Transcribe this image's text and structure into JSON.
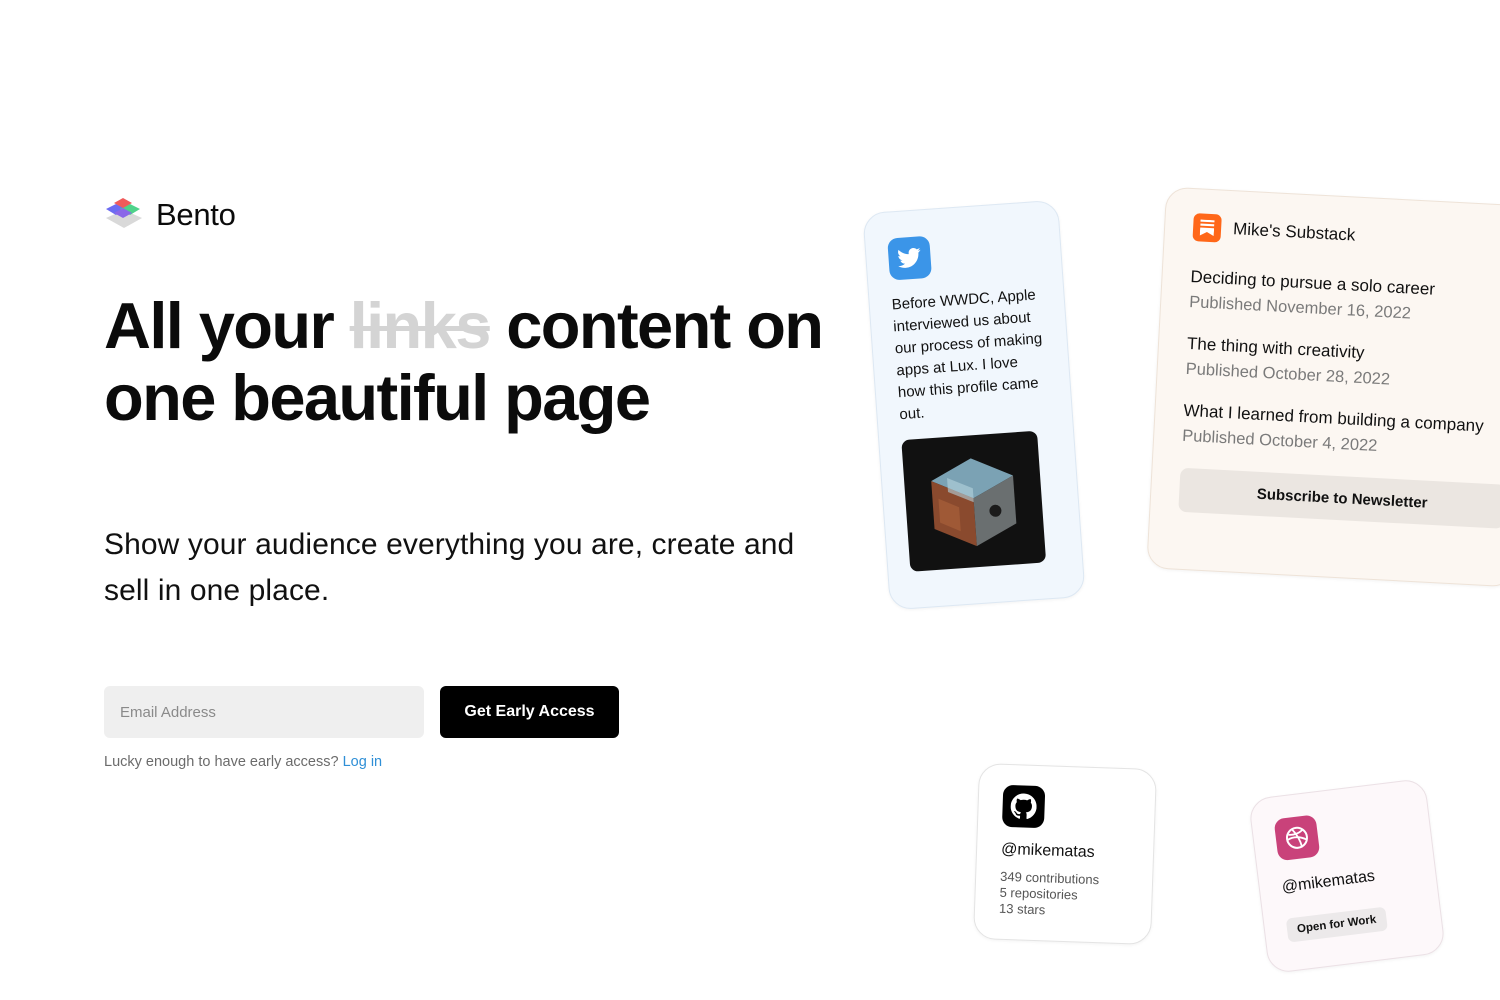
{
  "brand": {
    "name": "Bento"
  },
  "hero": {
    "headline_part1": "All your ",
    "headline_struck": "links",
    "headline_part2": " content on one beautiful page",
    "subhead": "Show your audience everything you are, create and sell in one place."
  },
  "signup": {
    "email_placeholder": "Email Address",
    "cta_label": "Get Early Access",
    "login_prompt": "Lucky enough to have early access?",
    "login_link": "Log in"
  },
  "cards": {
    "twitter": {
      "icon": "twitter-bird-icon",
      "text": "Before WWDC, Apple interviewed us about our process of making apps at Lux. I love how this profile came out."
    },
    "substack": {
      "icon": "substack-icon",
      "name": "Mike's Substack",
      "posts": [
        {
          "title": "Deciding to pursue a solo career",
          "date": "Published November 16, 2022"
        },
        {
          "title": "The thing with creativity",
          "date": "Published October 28, 2022"
        },
        {
          "title": "What I learned from building a company",
          "date": "Published October 4, 2022"
        }
      ],
      "button": "Subscribe to Newsletter"
    },
    "github": {
      "icon": "github-icon",
      "handle": "@mikematas",
      "contributions": "349 contributions",
      "repositories": "5 repositories",
      "stars": "13 stars"
    },
    "dribbble": {
      "icon": "dribbble-icon",
      "handle": "@mikematas",
      "badge": "Open for Work"
    }
  },
  "colors": {
    "twitter": "#3b95e8",
    "substack": "#ff6719",
    "dribbble": "#c9427a",
    "link": "#2f8fd6"
  }
}
